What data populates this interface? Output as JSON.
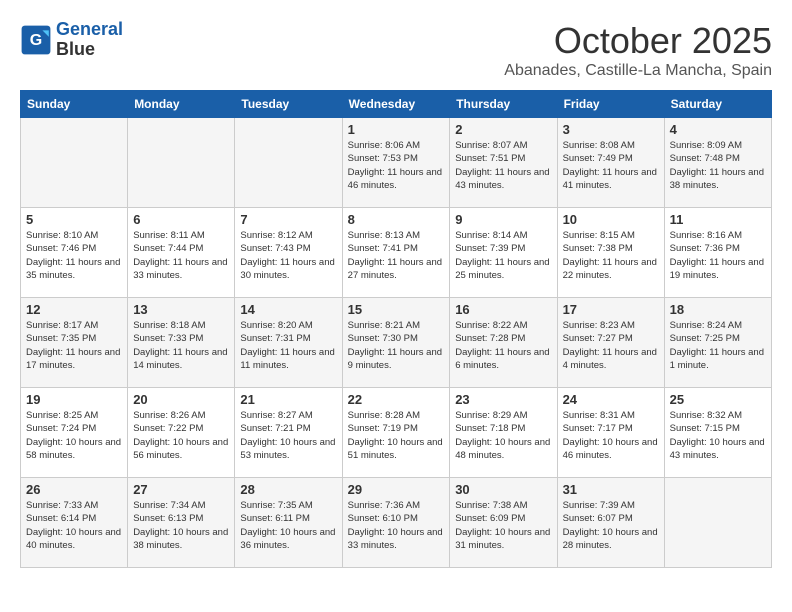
{
  "logo": {
    "line1": "General",
    "line2": "Blue"
  },
  "title": "October 2025",
  "location": "Abanades, Castille-La Mancha, Spain",
  "weekdays": [
    "Sunday",
    "Monday",
    "Tuesday",
    "Wednesday",
    "Thursday",
    "Friday",
    "Saturday"
  ],
  "weeks": [
    [
      {
        "day": "",
        "content": ""
      },
      {
        "day": "",
        "content": ""
      },
      {
        "day": "",
        "content": ""
      },
      {
        "day": "1",
        "content": "Sunrise: 8:06 AM\nSunset: 7:53 PM\nDaylight: 11 hours and 46 minutes."
      },
      {
        "day": "2",
        "content": "Sunrise: 8:07 AM\nSunset: 7:51 PM\nDaylight: 11 hours and 43 minutes."
      },
      {
        "day": "3",
        "content": "Sunrise: 8:08 AM\nSunset: 7:49 PM\nDaylight: 11 hours and 41 minutes."
      },
      {
        "day": "4",
        "content": "Sunrise: 8:09 AM\nSunset: 7:48 PM\nDaylight: 11 hours and 38 minutes."
      }
    ],
    [
      {
        "day": "5",
        "content": "Sunrise: 8:10 AM\nSunset: 7:46 PM\nDaylight: 11 hours and 35 minutes."
      },
      {
        "day": "6",
        "content": "Sunrise: 8:11 AM\nSunset: 7:44 PM\nDaylight: 11 hours and 33 minutes."
      },
      {
        "day": "7",
        "content": "Sunrise: 8:12 AM\nSunset: 7:43 PM\nDaylight: 11 hours and 30 minutes."
      },
      {
        "day": "8",
        "content": "Sunrise: 8:13 AM\nSunset: 7:41 PM\nDaylight: 11 hours and 27 minutes."
      },
      {
        "day": "9",
        "content": "Sunrise: 8:14 AM\nSunset: 7:39 PM\nDaylight: 11 hours and 25 minutes."
      },
      {
        "day": "10",
        "content": "Sunrise: 8:15 AM\nSunset: 7:38 PM\nDaylight: 11 hours and 22 minutes."
      },
      {
        "day": "11",
        "content": "Sunrise: 8:16 AM\nSunset: 7:36 PM\nDaylight: 11 hours and 19 minutes."
      }
    ],
    [
      {
        "day": "12",
        "content": "Sunrise: 8:17 AM\nSunset: 7:35 PM\nDaylight: 11 hours and 17 minutes."
      },
      {
        "day": "13",
        "content": "Sunrise: 8:18 AM\nSunset: 7:33 PM\nDaylight: 11 hours and 14 minutes."
      },
      {
        "day": "14",
        "content": "Sunrise: 8:20 AM\nSunset: 7:31 PM\nDaylight: 11 hours and 11 minutes."
      },
      {
        "day": "15",
        "content": "Sunrise: 8:21 AM\nSunset: 7:30 PM\nDaylight: 11 hours and 9 minutes."
      },
      {
        "day": "16",
        "content": "Sunrise: 8:22 AM\nSunset: 7:28 PM\nDaylight: 11 hours and 6 minutes."
      },
      {
        "day": "17",
        "content": "Sunrise: 8:23 AM\nSunset: 7:27 PM\nDaylight: 11 hours and 4 minutes."
      },
      {
        "day": "18",
        "content": "Sunrise: 8:24 AM\nSunset: 7:25 PM\nDaylight: 11 hours and 1 minute."
      }
    ],
    [
      {
        "day": "19",
        "content": "Sunrise: 8:25 AM\nSunset: 7:24 PM\nDaylight: 10 hours and 58 minutes."
      },
      {
        "day": "20",
        "content": "Sunrise: 8:26 AM\nSunset: 7:22 PM\nDaylight: 10 hours and 56 minutes."
      },
      {
        "day": "21",
        "content": "Sunrise: 8:27 AM\nSunset: 7:21 PM\nDaylight: 10 hours and 53 minutes."
      },
      {
        "day": "22",
        "content": "Sunrise: 8:28 AM\nSunset: 7:19 PM\nDaylight: 10 hours and 51 minutes."
      },
      {
        "day": "23",
        "content": "Sunrise: 8:29 AM\nSunset: 7:18 PM\nDaylight: 10 hours and 48 minutes."
      },
      {
        "day": "24",
        "content": "Sunrise: 8:31 AM\nSunset: 7:17 PM\nDaylight: 10 hours and 46 minutes."
      },
      {
        "day": "25",
        "content": "Sunrise: 8:32 AM\nSunset: 7:15 PM\nDaylight: 10 hours and 43 minutes."
      }
    ],
    [
      {
        "day": "26",
        "content": "Sunrise: 7:33 AM\nSunset: 6:14 PM\nDaylight: 10 hours and 40 minutes."
      },
      {
        "day": "27",
        "content": "Sunrise: 7:34 AM\nSunset: 6:13 PM\nDaylight: 10 hours and 38 minutes."
      },
      {
        "day": "28",
        "content": "Sunrise: 7:35 AM\nSunset: 6:11 PM\nDaylight: 10 hours and 36 minutes."
      },
      {
        "day": "29",
        "content": "Sunrise: 7:36 AM\nSunset: 6:10 PM\nDaylight: 10 hours and 33 minutes."
      },
      {
        "day": "30",
        "content": "Sunrise: 7:38 AM\nSunset: 6:09 PM\nDaylight: 10 hours and 31 minutes."
      },
      {
        "day": "31",
        "content": "Sunrise: 7:39 AM\nSunset: 6:07 PM\nDaylight: 10 hours and 28 minutes."
      },
      {
        "day": "",
        "content": ""
      }
    ]
  ]
}
